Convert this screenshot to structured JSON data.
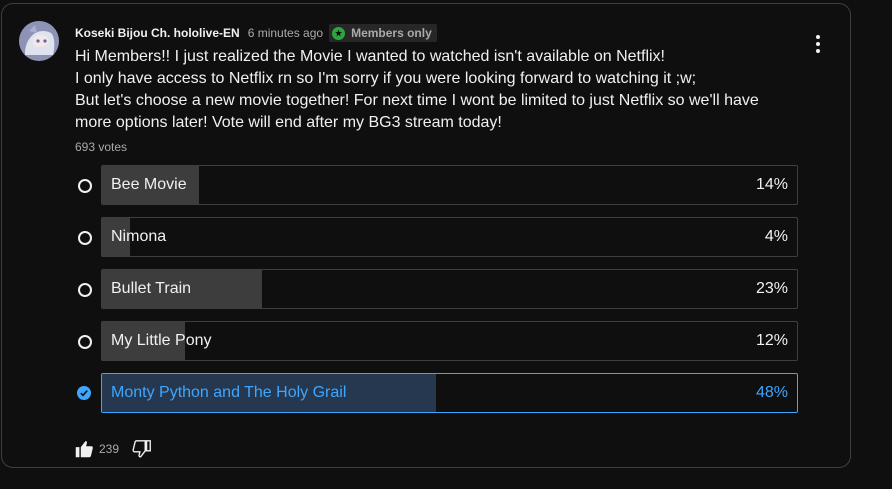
{
  "post": {
    "author": "Koseki Bijou Ch. hololive-EN",
    "time": "6 minutes ago",
    "badge_label": "Members only",
    "text_lines": [
      "Hi Members!! I just realized the Movie I wanted to watched isn't available on Netflix!",
      "I only have access to Netflix rn so I'm sorry if you were looking forward to watching it ;w;",
      "But let's choose a new movie together! For next time I wont be limited to just Netflix so we'll have",
      "more options later! Vote will end after my BG3 stream today!"
    ],
    "votes_label": "693 votes"
  },
  "poll": {
    "options": [
      {
        "label": "Bee Movie",
        "percent_label": "14%",
        "percent": 14,
        "selected": false
      },
      {
        "label": "Nimona",
        "percent_label": "4%",
        "percent": 4,
        "selected": false
      },
      {
        "label": "Bullet Train",
        "percent_label": "23%",
        "percent": 23,
        "selected": false
      },
      {
        "label": "My Little Pony",
        "percent_label": "12%",
        "percent": 12,
        "selected": false
      },
      {
        "label": "Monty Python and The Holy Grail",
        "percent_label": "48%",
        "percent": 48,
        "selected": true
      }
    ]
  },
  "actions": {
    "like_count": "239",
    "like_icon": "thumbs-up-icon",
    "dislike_icon": "thumbs-down-icon",
    "menu_icon": "more-vert-icon"
  },
  "colors": {
    "accent": "#3ea6ff",
    "members_badge": "#2ba640",
    "background": "#0f0f0f"
  }
}
